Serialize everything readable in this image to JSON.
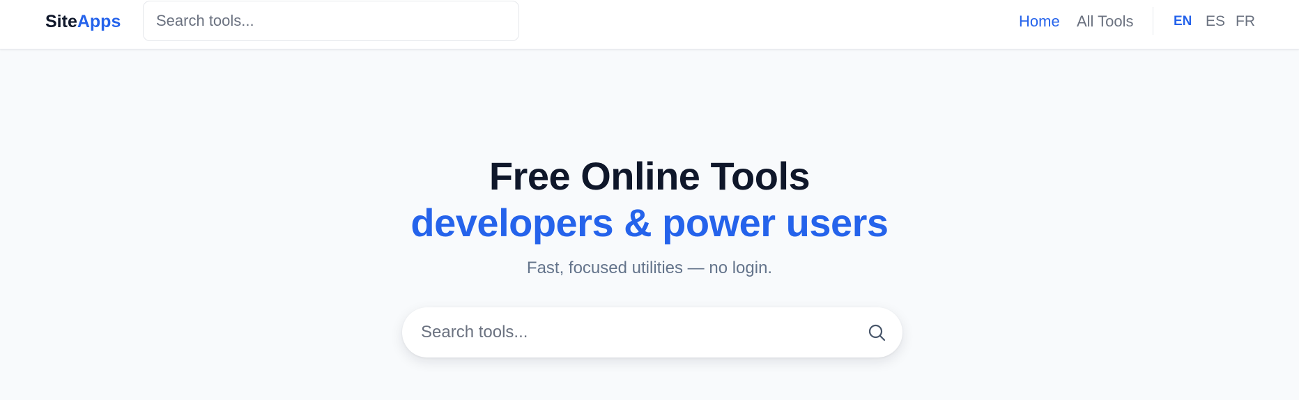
{
  "header": {
    "logo": {
      "part1": "Site",
      "part2": "Apps"
    },
    "search": {
      "placeholder": "Search tools..."
    },
    "nav": {
      "home": "Home",
      "all_tools": "All Tools"
    },
    "languages": {
      "en": "EN",
      "es": "ES",
      "fr": "FR",
      "active": "EN"
    }
  },
  "hero": {
    "title_line1": "Free Online Tools",
    "title_line2": "developers & power users",
    "subtitle": "Fast, focused utilities — no login.",
    "search": {
      "placeholder": "Search tools...",
      "icon": "search-icon"
    }
  },
  "colors": {
    "accent": "#2563eb",
    "heading": "#0f172a",
    "muted": "#64748b",
    "background": "#f8fafc"
  }
}
